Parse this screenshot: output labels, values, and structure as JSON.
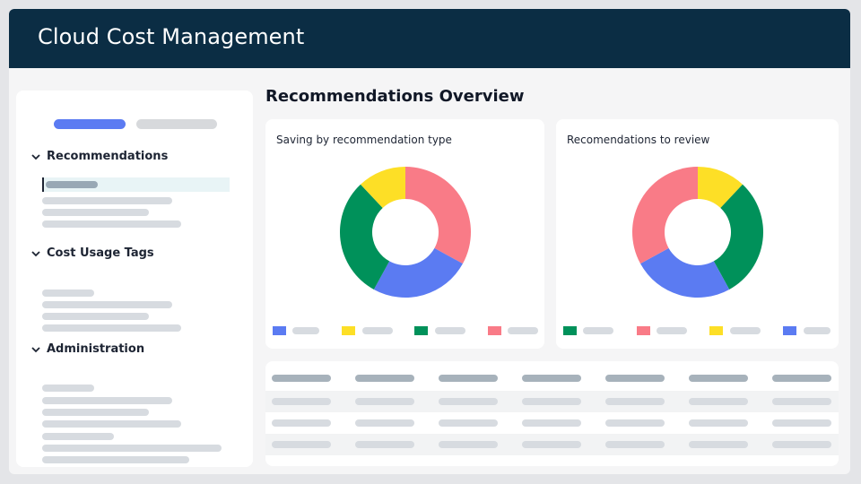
{
  "header": {
    "title": "Cloud Cost Management"
  },
  "sidebar": {
    "sections": [
      {
        "label": "Recommendations"
      },
      {
        "label": "Cost Usage Tags"
      },
      {
        "label": "Administration"
      }
    ]
  },
  "main": {
    "title": "Recommendations Overview",
    "cards": [
      {
        "title": "Saving by recommendation type"
      },
      {
        "title": "Recomendations to review"
      }
    ]
  },
  "colors": {
    "header_bg": "#0b2d44",
    "accent_blue": "#5b7bf2",
    "green": "#00915a",
    "yellow": "#fddf26",
    "pink": "#f97b87"
  },
  "icons": {
    "section_toggle": "chevron-down-icon"
  },
  "chart_data": [
    {
      "type": "pie",
      "title": "Saving by recommendation type",
      "labels": [
        "",
        "",
        "",
        ""
      ],
      "series": [
        {
          "values": [
            33,
            25,
            30,
            12
          ],
          "colors": [
            "#f97b87",
            "#5b7bf2",
            "#00915a",
            "#fddf26"
          ]
        }
      ]
    },
    {
      "type": "pie",
      "title": "Recomendations to review",
      "labels": [
        "",
        "",
        "",
        ""
      ],
      "series": [
        {
          "values": [
            12,
            30,
            25,
            33
          ],
          "colors": [
            "#fddf26",
            "#00915a",
            "#5b7bf2",
            "#f97b87"
          ]
        }
      ]
    }
  ]
}
